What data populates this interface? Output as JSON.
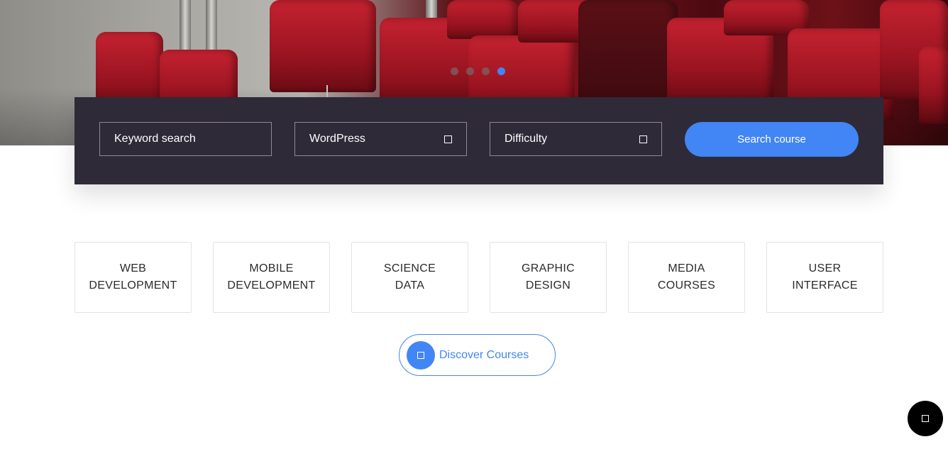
{
  "hero": {
    "slider_dots": 4,
    "active_dot": 4
  },
  "search": {
    "keyword_placeholder": "Keyword search",
    "category_value": "WordPress",
    "difficulty_value": "Difficulty",
    "button_label": "Search course"
  },
  "categories": [
    {
      "line1": "WEB",
      "line2": "DEVELOPMENT"
    },
    {
      "line1": "MOBILE",
      "line2": "DEVELOPMENT"
    },
    {
      "line1": "SCIENCE",
      "line2": "DATA"
    },
    {
      "line1": "GRAPHIC",
      "line2": "DESIGN"
    },
    {
      "line1": "MEDIA",
      "line2": "COURSES"
    },
    {
      "line1": "USER",
      "line2": "INTERFACE"
    }
  ],
  "discover": {
    "label": "Discover Courses"
  },
  "icons": {
    "dropdown": "chevron-down-icon",
    "discover": "arrow-icon",
    "chat": "chat-icon"
  },
  "colors": {
    "accent": "#4285f4",
    "panel": "#2e2a38"
  }
}
